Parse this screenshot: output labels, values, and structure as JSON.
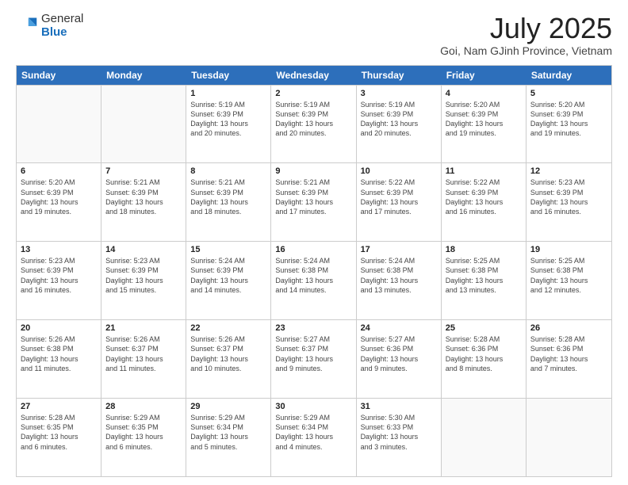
{
  "header": {
    "logo_line1": "General",
    "logo_line2": "Blue",
    "title": "July 2025",
    "subtitle": "Goi, Nam GJinh Province, Vietnam"
  },
  "days_of_week": [
    "Sunday",
    "Monday",
    "Tuesday",
    "Wednesday",
    "Thursday",
    "Friday",
    "Saturday"
  ],
  "weeks": [
    [
      {
        "day": "",
        "info": ""
      },
      {
        "day": "",
        "info": ""
      },
      {
        "day": "1",
        "info": "Sunrise: 5:19 AM\nSunset: 6:39 PM\nDaylight: 13 hours\nand 20 minutes."
      },
      {
        "day": "2",
        "info": "Sunrise: 5:19 AM\nSunset: 6:39 PM\nDaylight: 13 hours\nand 20 minutes."
      },
      {
        "day": "3",
        "info": "Sunrise: 5:19 AM\nSunset: 6:39 PM\nDaylight: 13 hours\nand 20 minutes."
      },
      {
        "day": "4",
        "info": "Sunrise: 5:20 AM\nSunset: 6:39 PM\nDaylight: 13 hours\nand 19 minutes."
      },
      {
        "day": "5",
        "info": "Sunrise: 5:20 AM\nSunset: 6:39 PM\nDaylight: 13 hours\nand 19 minutes."
      }
    ],
    [
      {
        "day": "6",
        "info": "Sunrise: 5:20 AM\nSunset: 6:39 PM\nDaylight: 13 hours\nand 19 minutes."
      },
      {
        "day": "7",
        "info": "Sunrise: 5:21 AM\nSunset: 6:39 PM\nDaylight: 13 hours\nand 18 minutes."
      },
      {
        "day": "8",
        "info": "Sunrise: 5:21 AM\nSunset: 6:39 PM\nDaylight: 13 hours\nand 18 minutes."
      },
      {
        "day": "9",
        "info": "Sunrise: 5:21 AM\nSunset: 6:39 PM\nDaylight: 13 hours\nand 17 minutes."
      },
      {
        "day": "10",
        "info": "Sunrise: 5:22 AM\nSunset: 6:39 PM\nDaylight: 13 hours\nand 17 minutes."
      },
      {
        "day": "11",
        "info": "Sunrise: 5:22 AM\nSunset: 6:39 PM\nDaylight: 13 hours\nand 16 minutes."
      },
      {
        "day": "12",
        "info": "Sunrise: 5:23 AM\nSunset: 6:39 PM\nDaylight: 13 hours\nand 16 minutes."
      }
    ],
    [
      {
        "day": "13",
        "info": "Sunrise: 5:23 AM\nSunset: 6:39 PM\nDaylight: 13 hours\nand 16 minutes."
      },
      {
        "day": "14",
        "info": "Sunrise: 5:23 AM\nSunset: 6:39 PM\nDaylight: 13 hours\nand 15 minutes."
      },
      {
        "day": "15",
        "info": "Sunrise: 5:24 AM\nSunset: 6:39 PM\nDaylight: 13 hours\nand 14 minutes."
      },
      {
        "day": "16",
        "info": "Sunrise: 5:24 AM\nSunset: 6:38 PM\nDaylight: 13 hours\nand 14 minutes."
      },
      {
        "day": "17",
        "info": "Sunrise: 5:24 AM\nSunset: 6:38 PM\nDaylight: 13 hours\nand 13 minutes."
      },
      {
        "day": "18",
        "info": "Sunrise: 5:25 AM\nSunset: 6:38 PM\nDaylight: 13 hours\nand 13 minutes."
      },
      {
        "day": "19",
        "info": "Sunrise: 5:25 AM\nSunset: 6:38 PM\nDaylight: 13 hours\nand 12 minutes."
      }
    ],
    [
      {
        "day": "20",
        "info": "Sunrise: 5:26 AM\nSunset: 6:38 PM\nDaylight: 13 hours\nand 11 minutes."
      },
      {
        "day": "21",
        "info": "Sunrise: 5:26 AM\nSunset: 6:37 PM\nDaylight: 13 hours\nand 11 minutes."
      },
      {
        "day": "22",
        "info": "Sunrise: 5:26 AM\nSunset: 6:37 PM\nDaylight: 13 hours\nand 10 minutes."
      },
      {
        "day": "23",
        "info": "Sunrise: 5:27 AM\nSunset: 6:37 PM\nDaylight: 13 hours\nand 9 minutes."
      },
      {
        "day": "24",
        "info": "Sunrise: 5:27 AM\nSunset: 6:36 PM\nDaylight: 13 hours\nand 9 minutes."
      },
      {
        "day": "25",
        "info": "Sunrise: 5:28 AM\nSunset: 6:36 PM\nDaylight: 13 hours\nand 8 minutes."
      },
      {
        "day": "26",
        "info": "Sunrise: 5:28 AM\nSunset: 6:36 PM\nDaylight: 13 hours\nand 7 minutes."
      }
    ],
    [
      {
        "day": "27",
        "info": "Sunrise: 5:28 AM\nSunset: 6:35 PM\nDaylight: 13 hours\nand 6 minutes."
      },
      {
        "day": "28",
        "info": "Sunrise: 5:29 AM\nSunset: 6:35 PM\nDaylight: 13 hours\nand 6 minutes."
      },
      {
        "day": "29",
        "info": "Sunrise: 5:29 AM\nSunset: 6:34 PM\nDaylight: 13 hours\nand 5 minutes."
      },
      {
        "day": "30",
        "info": "Sunrise: 5:29 AM\nSunset: 6:34 PM\nDaylight: 13 hours\nand 4 minutes."
      },
      {
        "day": "31",
        "info": "Sunrise: 5:30 AM\nSunset: 6:33 PM\nDaylight: 13 hours\nand 3 minutes."
      },
      {
        "day": "",
        "info": ""
      },
      {
        "day": "",
        "info": ""
      }
    ]
  ]
}
